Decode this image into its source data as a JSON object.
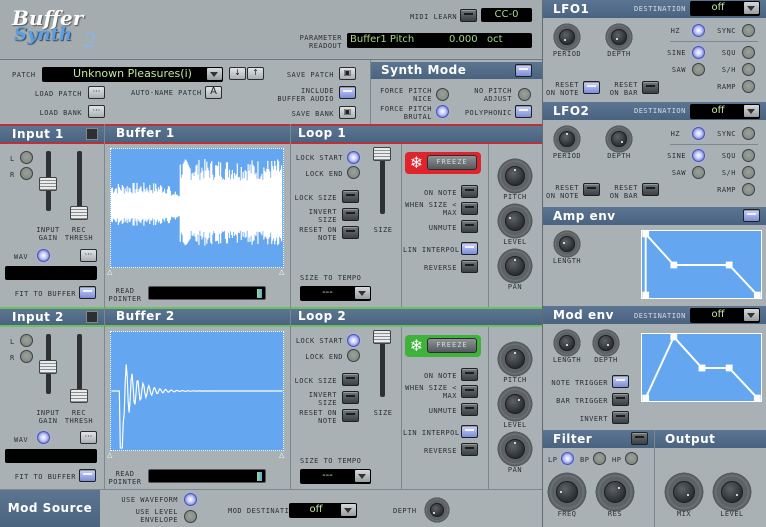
{
  "logo": {
    "line1": "Buffer",
    "line2": "Synth",
    "suffix": "2"
  },
  "top": {
    "midi_learn_label": "MIDI LEARN",
    "midi_cc": "CC-0",
    "param_readout_label": "PARAMETER READOUT",
    "param_readout_name": "Buffer1 Pitch",
    "param_readout_value": "0.000",
    "param_readout_unit": "oct"
  },
  "patch": {
    "label": "PATCH",
    "name": "Unknown Pleasures(i)",
    "down_label": "↓",
    "up_label": "↑",
    "load_patch": "LOAD PATCH",
    "load_bank": "LOAD BANK",
    "auto_name": "AUTO-NAME PATCH",
    "auto_name_btn": "A",
    "save_patch": "SAVE PATCH",
    "include_buffer_audio": "INCLUDE BUFFER AUDIO",
    "save_bank": "SAVE BANK",
    "ellipsis": "···",
    "include_buffer_audio_on": true
  },
  "synth_mode": {
    "title": "Synth Mode",
    "force_pitch_nice": "FORCE PITCH NICE",
    "force_pitch_brutal": "FORCE PITCH BRUTAL",
    "no_pitch_adjust": "NO PITCH ADJUST",
    "polyphonic": "POLYPHONIC",
    "selected": "force_pitch_brutal",
    "polyphonic_on": true
  },
  "lfo1": {
    "title": "LFO1",
    "destination_label": "DESTINATION",
    "destination": "off",
    "period": "PERIOD",
    "depth": "DEPTH",
    "hz": "HZ",
    "sync": "SYNC",
    "sine": "SINE",
    "squ": "SQU",
    "saw": "SAW",
    "sh": "S/H",
    "ramp": "RAMP",
    "reset_on_note": "RESET ON NOTE",
    "reset_on_bar": "RESET ON BAR",
    "rate_mode": "hz",
    "waveform": "sine",
    "reset_on_note_on": true,
    "reset_on_bar_on": false
  },
  "lfo2": {
    "title": "LFO2",
    "destination_label": "DESTINATION",
    "destination": "off",
    "period": "PERIOD",
    "depth": "DEPTH",
    "hz": "HZ",
    "sync": "SYNC",
    "sine": "SINE",
    "squ": "SQU",
    "saw": "SAW",
    "sh": "S/H",
    "ramp": "RAMP",
    "reset_on_note": "RESET ON NOTE",
    "reset_on_bar": "RESET ON BAR",
    "rate_mode": "hz",
    "waveform": "sine",
    "reset_on_note_on": false,
    "reset_on_bar_on": false
  },
  "amp_env": {
    "title": "Amp env",
    "length": "LENGTH",
    "enabled": true
  },
  "mod_env": {
    "title": "Mod env",
    "destination_label": "DESTINATION",
    "destination": "off",
    "length": "LENGTH",
    "depth": "DEPTH",
    "note_trigger": "NOTE TRIGGER",
    "bar_trigger": "BAR TRIGGER",
    "invert": "INVERT",
    "note_trigger_on": true
  },
  "filter": {
    "title": "Filter",
    "lp": "LP",
    "bp": "BP",
    "hp": "HP",
    "freq": "FREQ",
    "res": "RES",
    "mode": "lp"
  },
  "output": {
    "title": "Output",
    "mix": "MIX",
    "level": "LEVEL"
  },
  "inputs": [
    {
      "title": "Input 1",
      "l": "L",
      "r": "R",
      "input_gain": "INPUT GAIN",
      "rec_thresh": "REC THRESH",
      "wav": "WAV",
      "fit_to_buffer": "FIT TO BUFFER",
      "wav_on": true,
      "fit_on": true
    },
    {
      "title": "Input 2",
      "l": "L",
      "r": "R",
      "input_gain": "INPUT GAIN",
      "rec_thresh": "REC THRESH",
      "wav": "WAV",
      "fit_to_buffer": "FIT TO BUFFER",
      "wav_on": true,
      "fit_on": true
    }
  ],
  "buffers": [
    {
      "title": "Buffer 1",
      "read_pointer": "READ POINTER"
    },
    {
      "title": "Buffer 2",
      "read_pointer": "READ POINTER"
    }
  ],
  "loops": [
    {
      "title": "Loop 1",
      "lock_start": "LOCK START",
      "lock_end": "LOCK END",
      "lock_size": "LOCK SIZE",
      "invert_size": "INVERT SIZE",
      "reset_on_note": "RESET ON NOTE",
      "size": "SIZE",
      "size_to_tempo": "SIZE TO TEMPO",
      "size_to_tempo_value": "---",
      "freeze": "FREEZE",
      "freeze_color": "#e0242c",
      "on_note": "ON NOTE",
      "when_size_max": "WHEN SIZE < MAX",
      "unmute": "UNMUTE",
      "lin_interpol": "LIN INTERPOL",
      "reverse": "REVERSE",
      "pitch": "PITCH",
      "level": "LEVEL",
      "pan": "PAN"
    },
    {
      "title": "Loop 2",
      "lock_start": "LOCK START",
      "lock_end": "LOCK END",
      "lock_size": "LOCK SIZE",
      "invert_size": "INVERT SIZE",
      "reset_on_note": "RESET ON NOTE",
      "size": "SIZE",
      "size_to_tempo": "SIZE TO TEMPO",
      "size_to_tempo_value": "---",
      "freeze": "FREEZE",
      "freeze_color": "#3fb23a",
      "on_note": "ON NOTE",
      "when_size_max": "WHEN SIZE < MAX",
      "unmute": "UNMUTE",
      "lin_interpol": "LIN INTERPOL",
      "reverse": "REVERSE",
      "pitch": "PITCH",
      "level": "LEVEL",
      "pan": "PAN"
    }
  ],
  "mod_source": {
    "title": "Mod Source",
    "use_waveform": "USE WAVEFORM",
    "use_level_envelope": "USE LEVEL ENVELOPE",
    "mod_destination_label": "MOD DESTINATION",
    "mod_destination": "off",
    "depth": "DEPTH",
    "selected": "use_waveform"
  }
}
